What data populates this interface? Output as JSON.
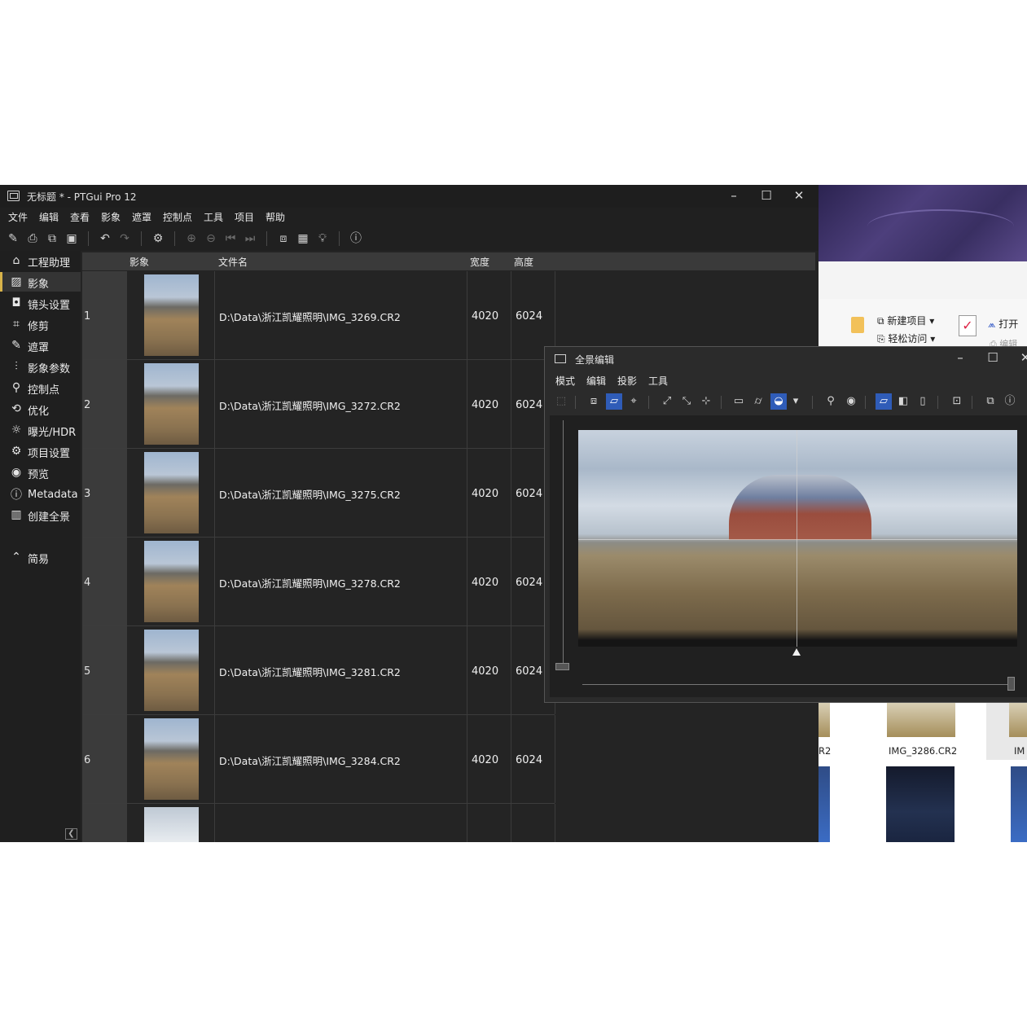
{
  "app": {
    "title": "无标题 * - PTGui Pro 12",
    "menu": [
      "文件",
      "编辑",
      "查看",
      "影象",
      "遮罩",
      "控制点",
      "工具",
      "项目",
      "帮助"
    ]
  },
  "sidebar": {
    "items": [
      {
        "label": "工程助理",
        "icon": "home-icon",
        "glyph": "⌂"
      },
      {
        "label": "影象",
        "icon": "image-icon",
        "glyph": "▨"
      },
      {
        "label": "镜头设置",
        "icon": "camera-icon",
        "glyph": "◘"
      },
      {
        "label": "修剪",
        "icon": "crop-icon",
        "glyph": "⌗"
      },
      {
        "label": "遮罩",
        "icon": "brush-icon",
        "glyph": "✎"
      },
      {
        "label": "影象参数",
        "icon": "sliders-icon",
        "glyph": "⫶"
      },
      {
        "label": "控制点",
        "icon": "control-points-icon",
        "glyph": "⚲"
      },
      {
        "label": "优化",
        "icon": "optimize-icon",
        "glyph": "⟲"
      },
      {
        "label": "曝光/HDR",
        "icon": "sun-icon",
        "glyph": "☼"
      },
      {
        "label": "项目设置",
        "icon": "gear-icon",
        "glyph": "⚙"
      },
      {
        "label": "预览",
        "icon": "eye-icon",
        "glyph": "◉"
      },
      {
        "label": "Metadata",
        "icon": "info-icon",
        "glyph": "ⓘ"
      },
      {
        "label": "创建全景",
        "icon": "panorama-icon",
        "glyph": "▥"
      },
      {
        "label": "简易",
        "icon": "chevron-up-circle-icon",
        "glyph": "⌃"
      }
    ],
    "active_index": 1
  },
  "table": {
    "headers": {
      "image": "影象",
      "filename": "文件名",
      "width": "宽度",
      "height": "高度"
    },
    "rows": [
      {
        "num": "1",
        "file": "D:\\Data\\浙江凯耀照明\\IMG_3269.CR2",
        "width": "4020",
        "height": "6024"
      },
      {
        "num": "2",
        "file": "D:\\Data\\浙江凯耀照明\\IMG_3272.CR2",
        "width": "4020",
        "height": "6024"
      },
      {
        "num": "3",
        "file": "D:\\Data\\浙江凯耀照明\\IMG_3275.CR2",
        "width": "4020",
        "height": "6024"
      },
      {
        "num": "4",
        "file": "D:\\Data\\浙江凯耀照明\\IMG_3278.CR2",
        "width": "4020",
        "height": "6024"
      },
      {
        "num": "5",
        "file": "D:\\Data\\浙江凯耀照明\\IMG_3281.CR2",
        "width": "4020",
        "height": "6024"
      },
      {
        "num": "6",
        "file": "D:\\Data\\浙江凯耀照明\\IMG_3284.CR2",
        "width": "4020",
        "height": "6024"
      }
    ]
  },
  "pano_editor": {
    "title": "全景编辑",
    "menu": [
      "模式",
      "编辑",
      "投影",
      "工具"
    ]
  },
  "explorer": {
    "new_item": "新建项目",
    "easy_access": "轻松访问",
    "open": "打开",
    "edit": "编辑",
    "file_label_left": "R2",
    "file_label_mid": "IMG_3286.CR2",
    "file_label_right": "IM"
  }
}
